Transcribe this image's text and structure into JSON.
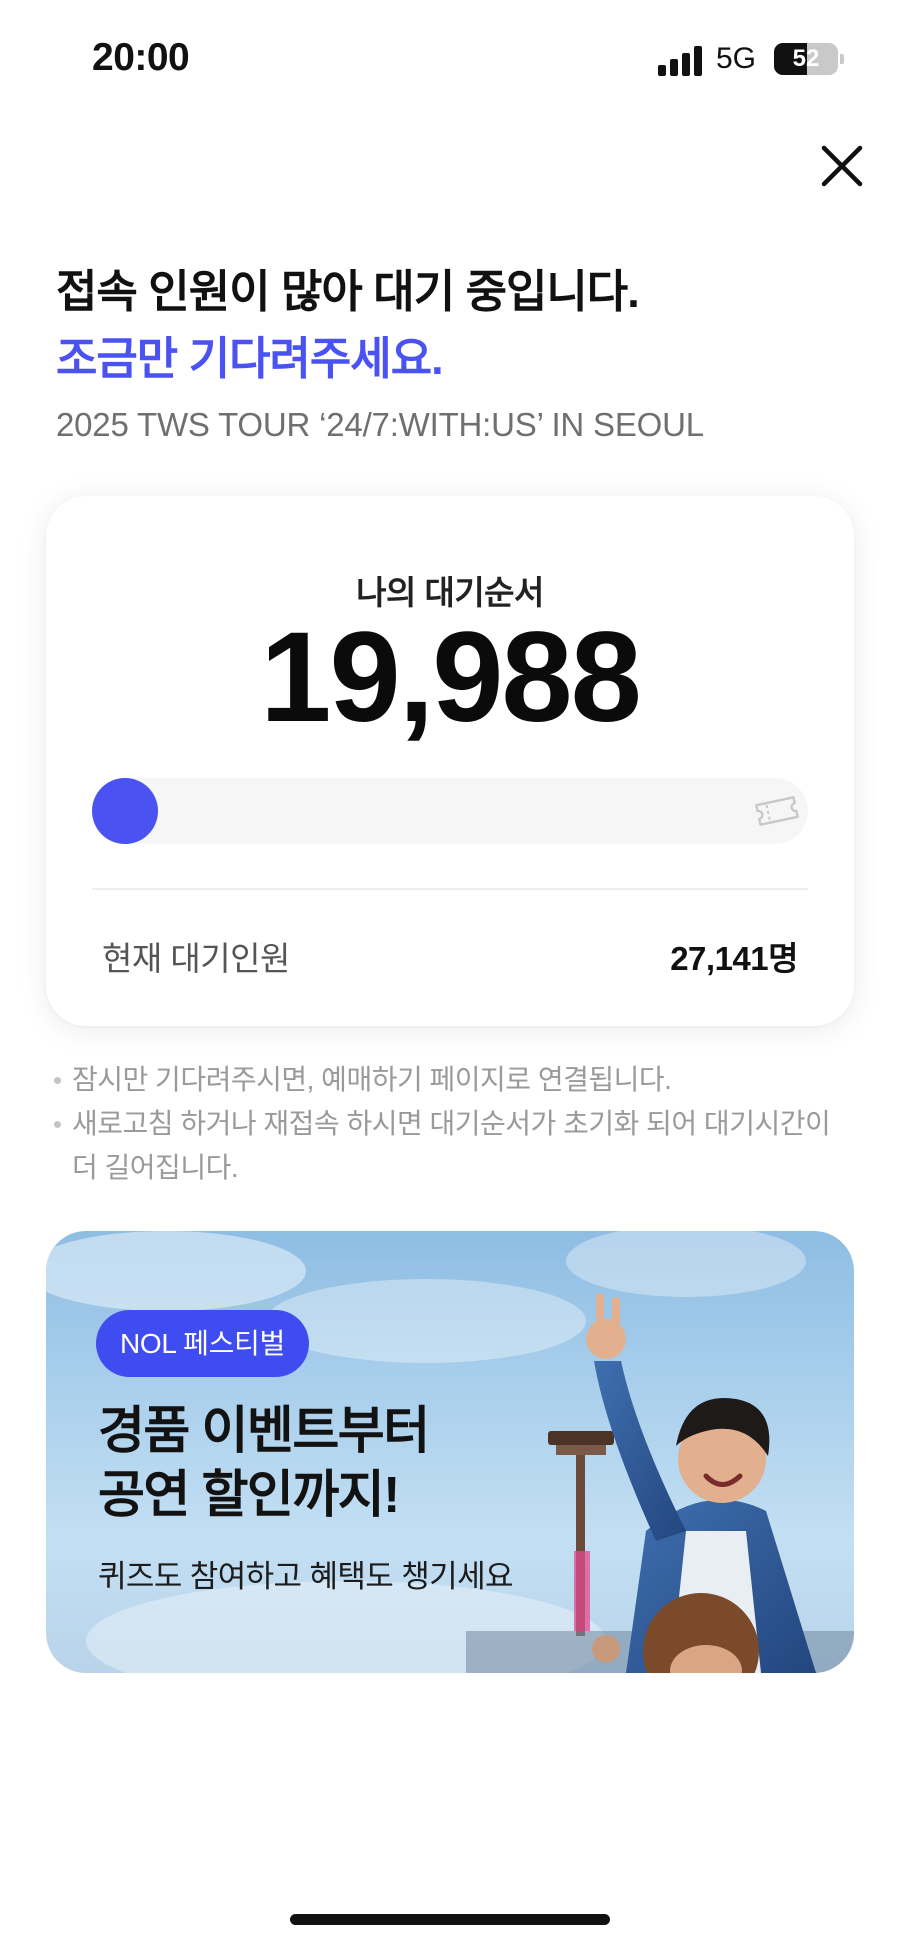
{
  "status_bar": {
    "time": "20:00",
    "network": "5G",
    "battery_percent": "52",
    "battery_level": 0.52,
    "signal_icon": "signal-bars-icon",
    "battery_icon": "battery-icon"
  },
  "header": {
    "close_icon": "close-icon"
  },
  "heading": {
    "main": "접속 인원이 많아 대기 중입니다.",
    "sub": "조금만 기다려주세요.",
    "event_title": "2025 TWS TOUR ‘24/7:WITH:US’ IN SEOUL"
  },
  "queue_card": {
    "label": "나의 대기순서",
    "number": "19,988",
    "progress": 0.0,
    "progress_icon": "ticket-icon",
    "waiting_label": "현재 대기인원",
    "waiting_count": "27,141명"
  },
  "notices": [
    "잠시만 기다려주시면, 예매하기 페이지로 연결됩니다.",
    "새로고침 하거나 재접속 하시면 대기순서가 초기화 되어 대기시간이 더 길어집니다."
  ],
  "banner": {
    "badge": "NOL 페스티벌",
    "headline_line1": "경품 이벤트부터",
    "headline_line2": "공연 할인까지!",
    "subtext": "퀴즈도 참여하고 혜택도 챙기세요"
  },
  "colors": {
    "accent": "#4a53f2",
    "badge": "#3e4cf0",
    "muted_text": "#9a9a9a",
    "track": "#f6f6f6"
  }
}
